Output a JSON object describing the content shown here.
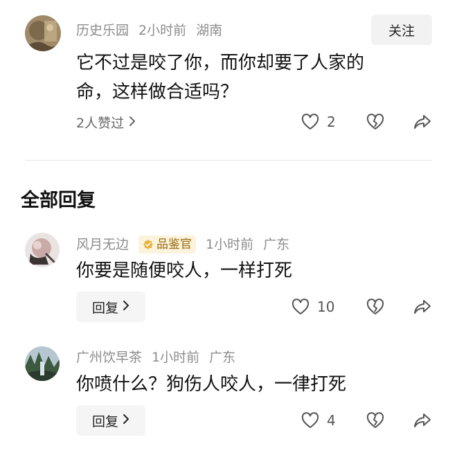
{
  "comment": {
    "username": "历史乐园",
    "time": "2小时前",
    "location": "湖南",
    "follow_label": "关注",
    "text_line1": "它不过是咬了你，而你却要了人家的",
    "text_line2": "命，这样做合适吗？",
    "likers_label": "2人赞过",
    "like_count": "2"
  },
  "section_title": "全部回复",
  "replies": [
    {
      "username": "风月无边",
      "badge": "品鉴官",
      "time": "1小时前",
      "location": "广东",
      "text": "你要是随便咬人，一样打死",
      "reply_label": "回复",
      "like_count": "10"
    },
    {
      "username": "广州饮早茶",
      "time": "1小时前",
      "location": "广东",
      "text": "你喷什么？狗伤人咬人，一律打死",
      "reply_label": "回复",
      "like_count": "4"
    }
  ],
  "icons": {
    "like": "heart-outline-icon",
    "dislike": "broken-heart-icon",
    "share": "share-arrow-icon",
    "chevron": "chevron-right-icon",
    "badge": "verified-check-icon"
  },
  "colors": {
    "text": "#111111",
    "meta": "#8c8c8c",
    "badge_bg": "#fbf3dc",
    "badge_fg": "#9a6a12",
    "button_bg": "#f2f2f2"
  }
}
